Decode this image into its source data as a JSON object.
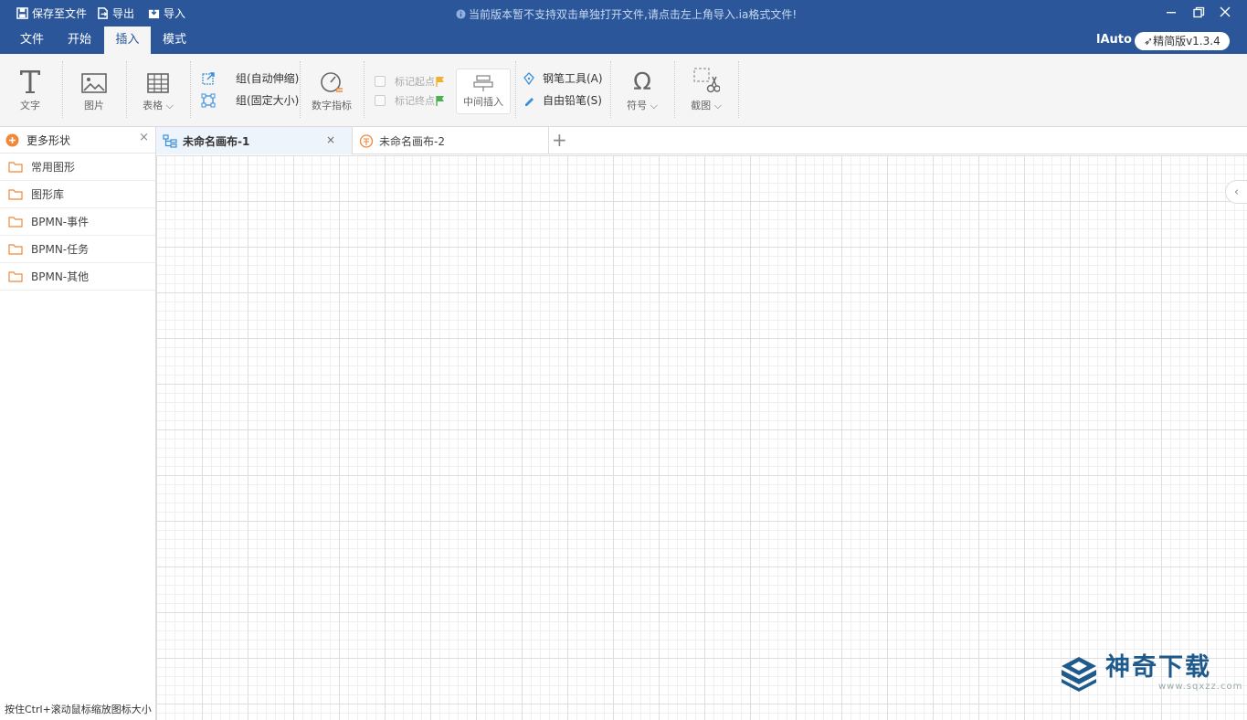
{
  "titlebar": {
    "save_file": "保存至文件",
    "export": "导出",
    "import": "导入",
    "notice": "当前版本暂不支持双击单独打开文件,请点击左上角导入.ia格式文件!"
  },
  "menu": {
    "items": [
      "文件",
      "开始",
      "插入",
      "模式"
    ],
    "active": "插入",
    "user": "lAuto",
    "version": "精简版v1.3.4"
  },
  "ribbon": {
    "text": "文字",
    "image": "图片",
    "table": "表格",
    "group_auto": "组(自动伸缩)",
    "group_fixed": "组(固定大小)",
    "digit_indicator": "数字指标",
    "mark_start": "标记起点",
    "mark_end": "标记终点",
    "middle_insert": "中间插入",
    "pen_tool": "钢笔工具(A)",
    "free_pencil": "自由铅笔(S)",
    "symbol": "符号",
    "screenshot": "截图"
  },
  "leftpanel": {
    "header": "更多形状",
    "items": [
      "常用图形",
      "图形库",
      "BPMN-事件",
      "BPMN-任务",
      "BPMN-其他"
    ],
    "status": "按住Ctrl+滚动鼠标缩放图标大小"
  },
  "tabs": [
    {
      "label": "未命名画布-1",
      "active": true
    },
    {
      "label": "未命名画布-2",
      "active": false
    }
  ],
  "watermark": {
    "main": "神奇下载",
    "sub": "www.sqxzz.com"
  },
  "colors": {
    "titlebar": "#2b579a",
    "accent_orange": "#f0883a",
    "folder": "#f0883a"
  }
}
